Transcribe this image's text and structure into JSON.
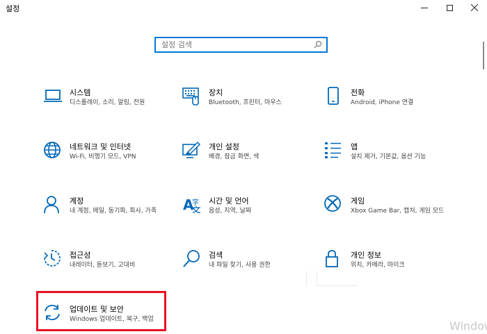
{
  "window": {
    "title": "설정",
    "watermark": "Window"
  },
  "search": {
    "placeholder": "설정 검색"
  },
  "tiles": [
    {
      "title": "시스템",
      "subtitle": "디스플레이, 소리, 알림, 전원",
      "icon": "laptop-icon"
    },
    {
      "title": "장치",
      "subtitle": "Bluetooth, 프린터, 마우스",
      "icon": "keyboard-icon"
    },
    {
      "title": "전화",
      "subtitle": "Android, iPhone 연결",
      "icon": "phone-icon"
    },
    {
      "title": "네트워크 및 인터넷",
      "subtitle": "Wi-Fi, 비행기 모드, VPN",
      "icon": "globe-icon"
    },
    {
      "title": "개인 설정",
      "subtitle": "배경, 잠금 화면, 색",
      "icon": "paint-icon"
    },
    {
      "title": "앱",
      "subtitle": "설치 제거, 기본값, 옵션 기능",
      "icon": "apps-list-icon"
    },
    {
      "title": "계정",
      "subtitle": "내 계정, 메일, 동기화, 회사, 가족",
      "icon": "person-icon"
    },
    {
      "title": "시간 및 언어",
      "subtitle": "음성, 지역, 날짜",
      "icon": "language-icon"
    },
    {
      "title": "게임",
      "subtitle": "Xbox Game Bar, 캡처, 게임 모드",
      "icon": "xbox-icon"
    },
    {
      "title": "접근성",
      "subtitle": "내레이터, 돋보기, 고대비",
      "icon": "ease-of-access-icon"
    },
    {
      "title": "검색",
      "subtitle": "내 파일 찾기, 사용 권한",
      "icon": "search-icon"
    },
    {
      "title": "개인 정보",
      "subtitle": "위치, 카메라, 마이크",
      "icon": "lock-icon"
    },
    {
      "title": "업데이트 및 보안",
      "subtitle": "Windows 업데이트, 복구, 백업",
      "icon": "sync-icon"
    }
  ],
  "colors": {
    "accent": "#0078d7",
    "highlight": "#e81123"
  }
}
